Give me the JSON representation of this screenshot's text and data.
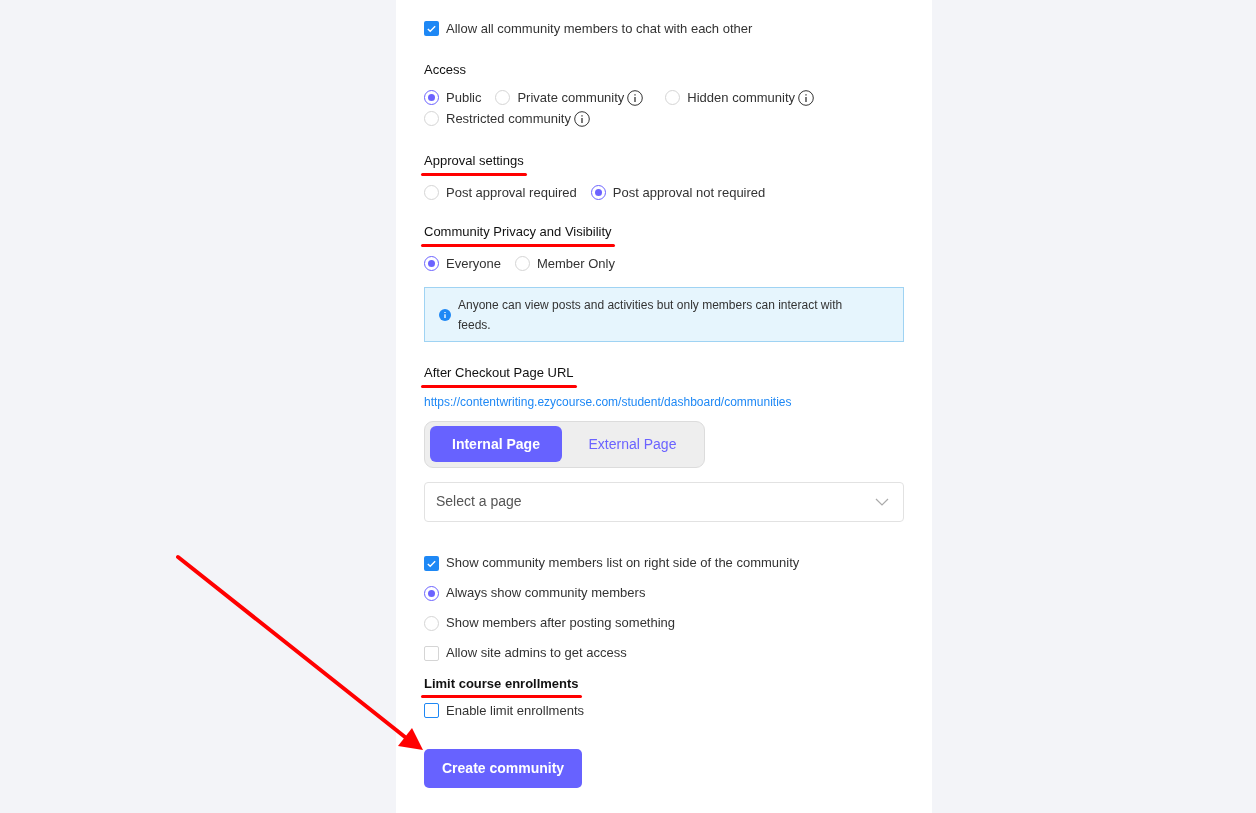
{
  "chat_option": {
    "label": "Allow all community members to chat with each other",
    "checked": true
  },
  "access": {
    "title": "Access",
    "options": [
      {
        "label": "Private community",
        "selected": false,
        "info": true
      },
      {
        "label": "Hidden community",
        "selected": false,
        "info": true
      },
      {
        "label": "Restricted community",
        "selected": false,
        "info": true
      }
    ],
    "first": {
      "label": "Public",
      "selected": true
    }
  },
  "approval": {
    "title": "Approval settings",
    "underlined": true,
    "options": [
      {
        "label": "Post approval required",
        "selected": false
      },
      {
        "label": "Post approval not required",
        "selected": true
      }
    ]
  },
  "privacy": {
    "title": "Community Privacy and Visibility",
    "underlined": true,
    "options": [
      {
        "label": "Everyone",
        "selected": true
      },
      {
        "label": "Member Only",
        "selected": false
      }
    ],
    "notice": "Anyone can view posts and activities but only members can interact with feeds."
  },
  "checkout": {
    "title": "After Checkout Page URL",
    "underlined": true,
    "url": "https://contentwriting.ezycourse.com/student/dashboard/communities",
    "tabs": [
      {
        "label": "Internal Page",
        "selected": true
      },
      {
        "label": "External Page",
        "selected": false
      }
    ],
    "select": {
      "placeholder": "Select a page"
    }
  },
  "members": [
    {
      "kind": "checkbox",
      "label": "Show community members list on right side of the community",
      "checked": true
    },
    {
      "kind": "radio",
      "label": "Always show community members",
      "selected": true
    },
    {
      "kind": "radio",
      "label": "Show members after posting something",
      "selected": false
    },
    {
      "kind": "checkbox",
      "label": "Allow site admins to get access",
      "checked": false
    }
  ],
  "limit": {
    "title": "Limit course enrollments",
    "underlined": true,
    "option": {
      "label": "Enable limit enrollments",
      "checked": false
    }
  },
  "submit": "Create community",
  "annotation_arrow": true
}
